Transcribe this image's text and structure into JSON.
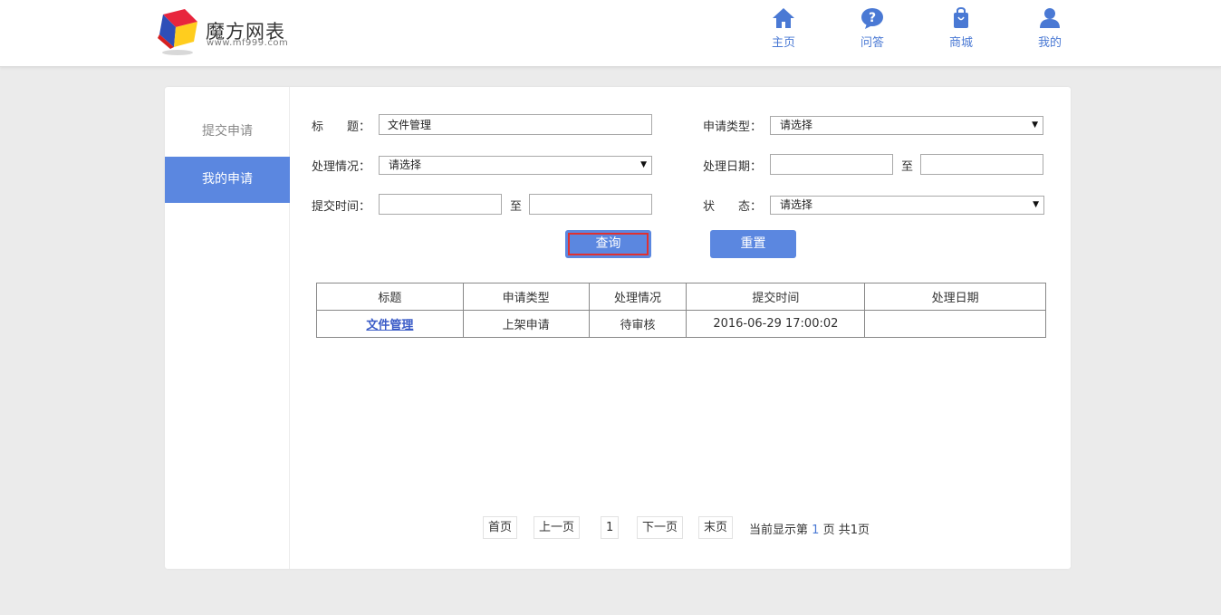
{
  "header": {
    "logo_name": "魔方网表",
    "logo_url": "www.mf999.com",
    "nav": [
      {
        "label": "主页",
        "icon": "home-icon"
      },
      {
        "label": "问答",
        "icon": "question-icon"
      },
      {
        "label": "商城",
        "icon": "shopping-bag-icon"
      },
      {
        "label": "我的",
        "icon": "user-icon"
      }
    ]
  },
  "sidebar": {
    "items": [
      {
        "label": "提交申请",
        "active": false
      },
      {
        "label": "我的申请",
        "active": true
      }
    ]
  },
  "form": {
    "title_label": "标　　题：",
    "title_value": "文件管理",
    "apply_type_label": "申请类型：",
    "apply_type_value": "请选择",
    "process_label": "处理情况：",
    "process_value": "请选择",
    "process_date_label": "处理日期：",
    "process_date_from": "",
    "process_date_to": "",
    "submit_time_label": "提交时间：",
    "submit_time_from": "",
    "submit_time_to": "",
    "to_label": "至",
    "status_label": "状　　态：",
    "status_value": "请选择",
    "query_label": "查询",
    "reset_label": "重置"
  },
  "table": {
    "headers": [
      "标题",
      "申请类型",
      "处理情况",
      "提交时间",
      "处理日期"
    ],
    "rows": [
      {
        "title": "文件管理",
        "type": "上架申请",
        "status": "待审核",
        "submit_time": "2016-06-29 17:00:02",
        "process_date": ""
      }
    ]
  },
  "pager": {
    "first": "首页",
    "prev": "上一页",
    "page": "1",
    "next": "下一页",
    "last": "末页",
    "info_prefix": "当前显示第",
    "current": "1",
    "info_suffix": "页 共1页"
  },
  "colors": {
    "accent": "#5b87e0",
    "nav_text": "#4a79d4",
    "highlight_border": "#e03131"
  }
}
